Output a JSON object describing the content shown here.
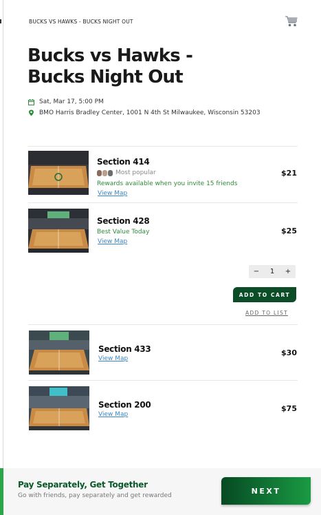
{
  "breadcrumb": "BUCKS VS HAWKS - BUCKS NIGHT OUT",
  "event": {
    "title": "Bucks vs Hawks - Bucks Night Out",
    "datetime": "Sat, Mar 17, 5:00 PM",
    "venue": "BMO Harris Bradley Center, 1001 N 4th St Milwaukee, Wisconsin 53203"
  },
  "icons": {
    "cart": "shopping-cart-icon",
    "calendar": "calendar-icon",
    "location": "map-pin-icon"
  },
  "tickets": [
    {
      "section": "Section 414",
      "popular": "Most popular",
      "promo": "Rewards available when you invite 15 friends",
      "view_map": "View Map",
      "price": "$21"
    },
    {
      "section": "Section 428",
      "promo": "Best Value Today",
      "view_map": "View Map",
      "price": "$25"
    },
    {
      "section": "Section 433",
      "view_map": "View Map",
      "price": "$30"
    },
    {
      "section": "Section 200",
      "view_map": "View Map",
      "price": "$75"
    }
  ],
  "stepper": {
    "minus": "−",
    "value": "1",
    "plus": "+"
  },
  "add_to_cart": "ADD TO CART",
  "add_to_list": "ADD TO LIST",
  "footer": {
    "title": "Pay Separately, Get Together",
    "subtitle": "Go with friends, pay separately and get rewarded",
    "next": "NEXT"
  },
  "colors": {
    "brand_green": "#0a4d26",
    "promo_green": "#2e8b3a",
    "link_blue": "#3a86c8"
  }
}
